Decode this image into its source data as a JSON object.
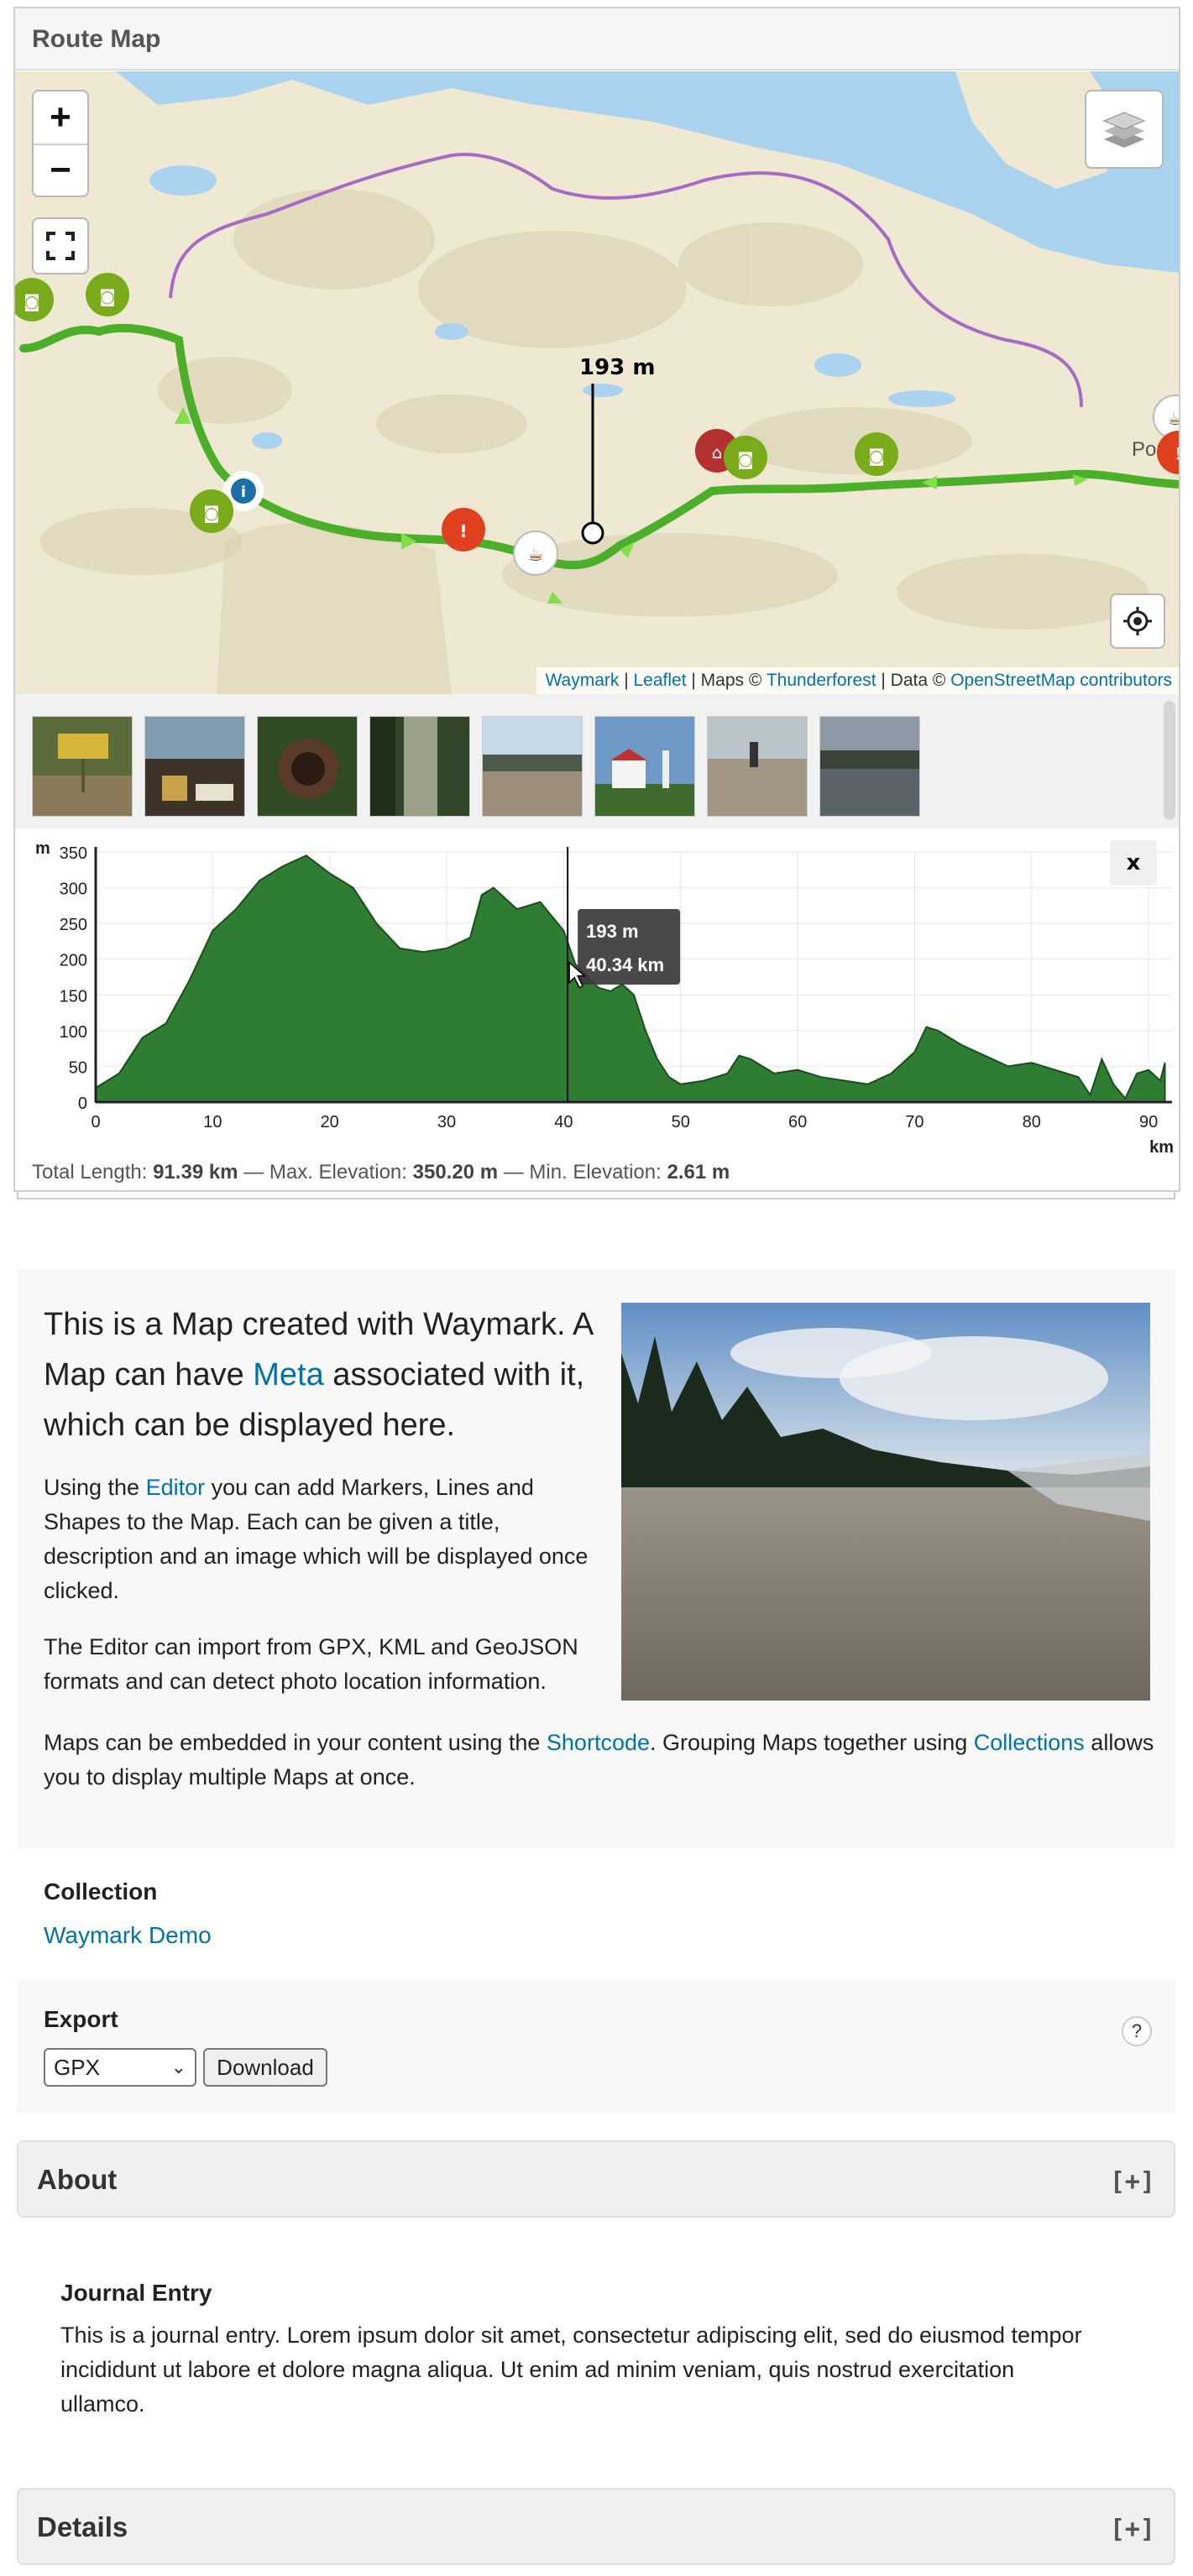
{
  "widget": {
    "title": "Route Map"
  },
  "map": {
    "zoom_in": "+",
    "zoom_out": "−",
    "place_label": "Port",
    "elevation_hover_label": "193 m",
    "attribution": {
      "waymark": "Waymark",
      "sep1": " | ",
      "leaflet": "Leaflet",
      "maps_text": " | Maps © ",
      "thunderforest": "Thunderforest",
      "data_text": " | Data © ",
      "osm": "OpenStreetMap contributors"
    },
    "colors": {
      "water": "#a9d3ef",
      "land": "#efe9d3",
      "route": "#4caf2a",
      "boundary": "#a66bc4",
      "photo_marker": "#7aab1a",
      "alert_marker": "#e0401e",
      "home_marker": "#b3312e"
    },
    "markers": [
      "camera-marker",
      "info-marker",
      "alert-marker",
      "coffee-marker",
      "home-marker"
    ]
  },
  "gallery": {
    "count": 8
  },
  "chart_data": {
    "type": "area",
    "title": "",
    "ylabel": "m",
    "xlabel": "km",
    "xlim": [
      0,
      92
    ],
    "ylim": [
      0,
      350
    ],
    "yticks": [
      0,
      50,
      100,
      150,
      200,
      250,
      300,
      350
    ],
    "xticks": [
      0,
      10,
      20,
      30,
      40,
      50,
      60,
      70,
      80,
      90
    ],
    "grid": true,
    "color": "#2e7d32",
    "x": [
      0,
      2,
      4,
      6,
      8,
      10,
      12,
      14,
      16,
      18,
      20,
      22,
      24,
      26,
      28,
      30,
      32,
      33,
      34,
      36,
      38,
      40,
      41,
      43,
      44,
      45,
      46,
      47,
      48,
      49,
      50,
      52,
      54,
      55,
      56,
      58,
      60,
      62,
      64,
      66,
      68,
      70,
      71,
      72,
      74,
      76,
      78,
      80,
      82,
      84,
      85,
      86,
      87,
      88,
      89,
      90,
      91,
      91.39
    ],
    "y": [
      20,
      40,
      90,
      110,
      170,
      240,
      270,
      310,
      330,
      345,
      320,
      300,
      250,
      215,
      210,
      215,
      230,
      290,
      300,
      270,
      280,
      240,
      193,
      160,
      155,
      165,
      150,
      100,
      60,
      35,
      25,
      30,
      40,
      65,
      60,
      40,
      45,
      35,
      30,
      25,
      40,
      70,
      105,
      100,
      80,
      65,
      50,
      55,
      45,
      35,
      10,
      60,
      25,
      5,
      40,
      45,
      30,
      55
    ],
    "hover": {
      "elevation": "193 m",
      "distance": "40.34 km",
      "x": 40.34,
      "y": 193
    }
  },
  "summary": {
    "length_label": "Total Length:",
    "length": "91.39 km",
    "sep1": "—",
    "max_label": "Max. Elevation:",
    "max": "350.20 m",
    "sep2": "—",
    "min_label": "Min. Elevation:",
    "min": "2.61 m"
  },
  "meta": {
    "lead_1": "This is a Map created with Waymark. A Map can have ",
    "lead_link": "Meta",
    "lead_2": " associated with it, which can be displayed here.",
    "p1_1": "Using the ",
    "p1_link": "Editor",
    "p1_2": " you can add Markers, Lines and Shapes to the Map. Each can be given a title, description and an image which will be displayed once clicked.",
    "p2": "The Editor can import from GPX, KML and GeoJSON formats and can detect photo location information.",
    "p3_1": "Maps can be embedded in your content using the ",
    "p3_link1": "Shortcode",
    "p3_2": ". Grouping Maps together using ",
    "p3_link2": "Collections",
    "p3_3": " allows you to display multiple Maps at once."
  },
  "collection": {
    "title": "Collection",
    "link": "Waymark Demo"
  },
  "export": {
    "title": "Export",
    "format": "GPX",
    "button": "Download",
    "help": "?"
  },
  "about": {
    "title": "About",
    "toggle": "[+]",
    "entry_title": "Journal Entry",
    "entry_text": "This is a journal entry. Lorem ipsum dolor sit amet, consectetur adipiscing elit, sed do eiusmod tempor incididunt ut labore et dolore magna aliqua. Ut enim ad minim veniam, quis nostrud exercitation ullamco."
  },
  "details": {
    "title": "Details",
    "toggle": "[+]"
  }
}
